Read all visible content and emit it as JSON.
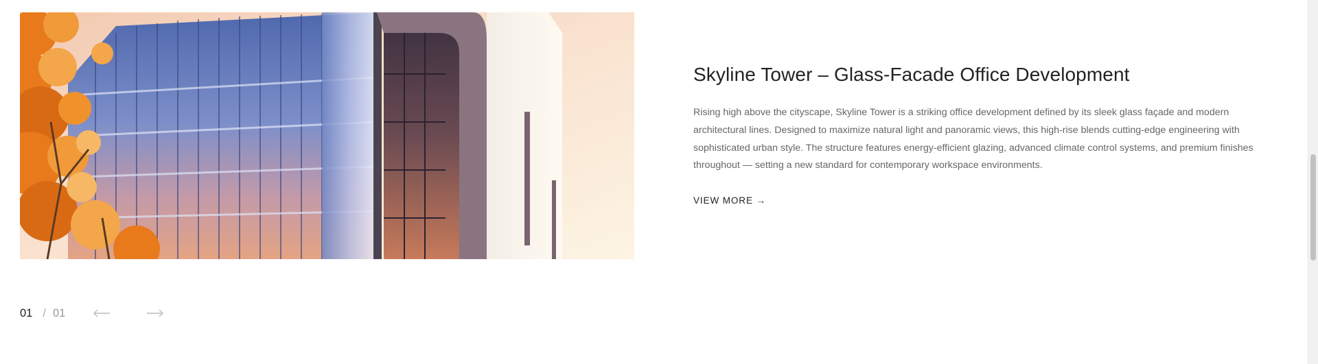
{
  "project": {
    "title": "Skyline Tower – Glass-Facade Office Development",
    "description": "Rising high above the cityscape, Skyline Tower is a striking office development defined by its sleek glass façade and modern architectural lines. Designed to maximize natural light and panoramic views, this high-rise blends cutting-edge engineering with sophisticated urban style. The structure features energy-efficient glazing, advanced climate control systems, and premium finishes throughout — setting a new standard for contemporary workspace environments.",
    "view_more_label": "VIEW MORE →"
  },
  "pager": {
    "current": "01",
    "separator": "/",
    "total": "01",
    "prev_icon": "arrow-left-icon",
    "next_icon": "arrow-right-icon"
  },
  "colors": {
    "text_dark": "#222222",
    "text_muted": "#666666",
    "pager_muted": "#999999",
    "arrow_muted": "#bbbbbb",
    "glass_blue": "#6f86c4",
    "autumn_orange": "#e87a1c"
  }
}
